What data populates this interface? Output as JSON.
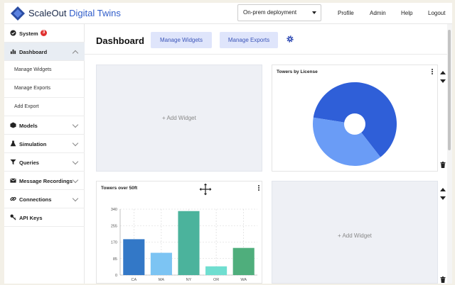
{
  "app": {
    "brand_part1": "ScaleOut",
    "brand_part2": "Digital Twins"
  },
  "topbar": {
    "deployment": "On-prem deployment",
    "nav": [
      "Profile",
      "Admin",
      "Help",
      "Logout"
    ]
  },
  "sidebar": {
    "system_badge": "3",
    "items": {
      "system": "System",
      "dashboard": "Dashboard",
      "manage_widgets": "Manage Widgets",
      "manage_exports": "Manage Exports",
      "add_export": "Add Export",
      "models": "Models",
      "simulation": "Simulation",
      "queries": "Queries",
      "message_recordings": "Message Recordings",
      "connections": "Connections",
      "api_keys": "API Keys"
    }
  },
  "main": {
    "title": "Dashboard",
    "manage_widgets_btn": "Manage Widgets",
    "manage_exports_btn": "Manage Exports",
    "add_widget": "+ Add Widget",
    "pie_title": "Towers by License",
    "bar_title": "Towers over 50ft"
  },
  "colors": {
    "accent": "#3b55b8",
    "button_bg": "#dfe5fb",
    "pie_primary": "#2f5fd8",
    "pie_secondary": "#6a9cf6"
  },
  "chart_data": [
    {
      "type": "pie",
      "title": "Towers by License",
      "slices": [
        {
          "label": "",
          "value": 62,
          "color": "#2f5fd8"
        },
        {
          "label": "",
          "value": 38,
          "color": "#6a9cf6"
        }
      ],
      "donut": true
    },
    {
      "type": "bar",
      "title": "Towers over 50ft",
      "categories": [
        "CA",
        "MA",
        "NY",
        "OR",
        "WA"
      ],
      "values": [
        185,
        115,
        330,
        45,
        140
      ],
      "colors": [
        "#3378c7",
        "#7cc4f3",
        "#4bb39c",
        "#6fded0",
        "#4fae7c"
      ],
      "yticks": [
        0,
        85,
        170,
        255,
        340
      ],
      "ylim": [
        0,
        340
      ],
      "grid": true
    }
  ]
}
